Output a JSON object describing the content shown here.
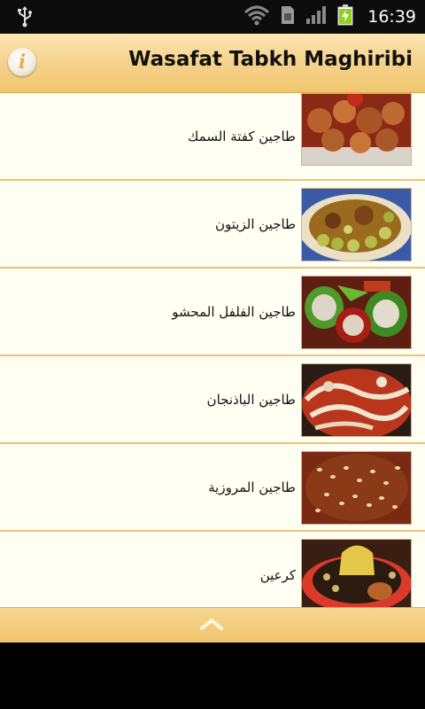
{
  "status_bar": {
    "time": "16:39",
    "icons": [
      "usb-icon",
      "wifi-icon",
      "sim-icon",
      "signal-icon",
      "battery-charging-icon"
    ]
  },
  "header": {
    "title": "Wasafat Tabkh Maghiribi",
    "info_icon": "info-icon"
  },
  "recipes": [
    {
      "name": "طاجين كفتة السمك",
      "thumb_icon": "fish-kefta-tagine-photo"
    },
    {
      "name": "طاجين الزيتون",
      "thumb_icon": "olive-tagine-photo"
    },
    {
      "name": "طاجين الفلفل المحشو",
      "thumb_icon": "stuffed-pepper-tagine-photo"
    },
    {
      "name": "طاجين الباذنجان",
      "thumb_icon": "eggplant-tagine-photo"
    },
    {
      "name": "طاجين المروزية",
      "thumb_icon": "mrouzia-tagine-photo"
    },
    {
      "name": "كرعين",
      "thumb_icon": "kraine-photo"
    }
  ],
  "footer": {
    "scroll_up_icon": "chevron-up-icon"
  },
  "colors": {
    "header": "#f6d48e",
    "list_bg": "#fffef2",
    "divider": "#eec27a",
    "footer": "#f0c46c"
  }
}
